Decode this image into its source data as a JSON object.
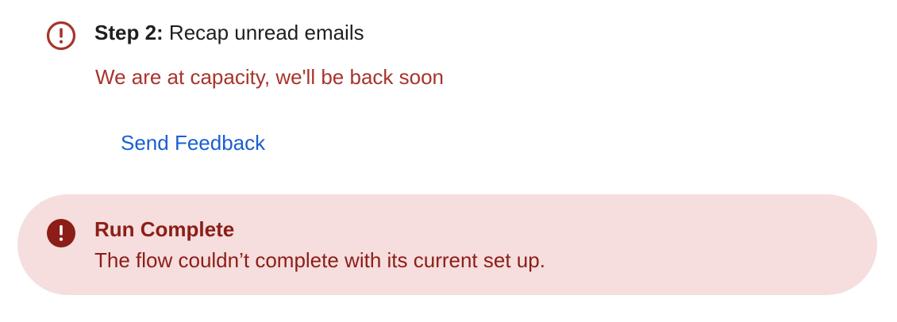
{
  "step": {
    "prefix": "Step 2:",
    "title": "Recap unread emails",
    "error_message": "We are at capacity, we'll be back soon",
    "icon": "error-outline-icon"
  },
  "feedback": {
    "label": "Send Feedback"
  },
  "banner": {
    "title": "Run Complete",
    "message": "The flow couldn’t complete with its current set up.",
    "icon": "error-filled-icon"
  },
  "colors": {
    "error_red": "#a8342c",
    "banner_bg": "#f5dedd",
    "banner_text": "#8c1d18",
    "link_blue": "#1a5fd1",
    "text_dark": "#1f1f1f"
  }
}
